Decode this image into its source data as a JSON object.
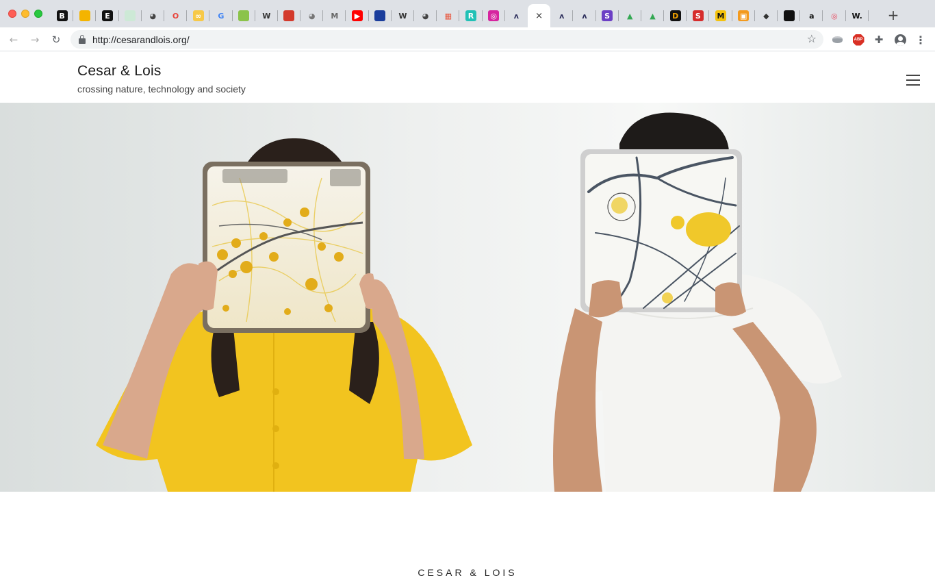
{
  "browser": {
    "tabs": [
      {
        "icon": "b-letter-icon",
        "glyph": "B",
        "bg": "#111111",
        "fg": "#ffffff"
      },
      {
        "icon": "yellow-slides-icon",
        "glyph": "",
        "bg": "#f4b400",
        "fg": "#ffffff"
      },
      {
        "icon": "e-letter-icon",
        "glyph": "E",
        "bg": "#111111",
        "fg": "#ffffff"
      },
      {
        "icon": "green-sheet-icon",
        "glyph": "",
        "bg": "#cde9d6",
        "fg": "#ffffff"
      },
      {
        "icon": "globe-icon",
        "glyph": "◕",
        "bg": "transparent",
        "fg": "#444444"
      },
      {
        "icon": "opera-icon",
        "glyph": "O",
        "bg": "transparent",
        "fg": "#e8453c"
      },
      {
        "icon": "infinity-icon",
        "glyph": "∞",
        "bg": "#f7c948",
        "fg": "#ffffff"
      },
      {
        "icon": "google-icon",
        "glyph": "G",
        "bg": "transparent",
        "fg": "#4285f4"
      },
      {
        "icon": "green-app-icon",
        "glyph": "",
        "bg": "#8bc34a",
        "fg": "#ffffff"
      },
      {
        "icon": "wikipedia-icon",
        "glyph": "W",
        "bg": "transparent",
        "fg": "#333333"
      },
      {
        "icon": "red-bookmark-icon",
        "glyph": "",
        "bg": "#d33a2c",
        "fg": "#ffffff"
      },
      {
        "icon": "globe-icon",
        "glyph": "◕",
        "bg": "transparent",
        "fg": "#777777"
      },
      {
        "icon": "medium-icon",
        "glyph": "M",
        "bg": "transparent",
        "fg": "#666666"
      },
      {
        "icon": "youtube-icon",
        "glyph": "▶",
        "bg": "#ff0000",
        "fg": "#ffffff"
      },
      {
        "icon": "blue-dot-icon",
        "glyph": "",
        "bg": "#1a3d9c",
        "fg": "#ffffff"
      },
      {
        "icon": "wikipedia-icon",
        "glyph": "W",
        "bg": "transparent",
        "fg": "#333333"
      },
      {
        "icon": "globe-icon",
        "glyph": "◕",
        "bg": "transparent",
        "fg": "#444444"
      },
      {
        "icon": "red-book-icon",
        "glyph": "▦",
        "bg": "transparent",
        "fg": "#e8553c"
      },
      {
        "icon": "r-letter-icon",
        "glyph": "R",
        "bg": "#21c1b6",
        "fg": "#ffffff"
      },
      {
        "icon": "instagram-icon",
        "glyph": "◎",
        "bg": "#d6249f",
        "fg": "#ffffff"
      },
      {
        "icon": "dark-a-icon",
        "glyph": "ʌ",
        "bg": "transparent",
        "fg": "#2b2d5b"
      },
      {
        "icon": "close-icon",
        "glyph": "×",
        "bg": "transparent",
        "fg": "#333333"
      },
      {
        "icon": "dark-a-icon",
        "glyph": "ʌ",
        "bg": "transparent",
        "fg": "#2b2d5b"
      },
      {
        "icon": "dark-a-icon",
        "glyph": "ʌ",
        "bg": "transparent",
        "fg": "#2b2d5b"
      },
      {
        "icon": "purple-s-icon",
        "glyph": "S",
        "bg": "#6c3fc5",
        "fg": "#ffffff"
      },
      {
        "icon": "google-drive-icon",
        "glyph": "▲",
        "bg": "transparent",
        "fg": "#34a853"
      },
      {
        "icon": "google-drive-icon",
        "glyph": "▲",
        "bg": "transparent",
        "fg": "#34a853"
      },
      {
        "icon": "d-letter-icon",
        "glyph": "D",
        "bg": "#111111",
        "fg": "#f4a300"
      },
      {
        "icon": "s-letter-icon",
        "glyph": "S",
        "bg": "#d62c2c",
        "fg": "#ffffff"
      },
      {
        "icon": "m-letter-icon",
        "glyph": "M",
        "bg": "#f4c20d",
        "fg": "#111111"
      },
      {
        "icon": "orange-grid-icon",
        "glyph": "▣",
        "bg": "#f39a1e",
        "fg": "#ffffff"
      },
      {
        "icon": "diamond-icon",
        "glyph": "◆",
        "bg": "transparent",
        "fg": "#333333"
      },
      {
        "icon": "black-circle-icon",
        "glyph": "",
        "bg": "#111111",
        "fg": "#ffffff"
      },
      {
        "icon": "amazon-icon",
        "glyph": "a",
        "bg": "transparent",
        "fg": "#111111"
      },
      {
        "icon": "target-icon",
        "glyph": "◎",
        "bg": "transparent",
        "fg": "#e84a5f"
      },
      {
        "icon": "w-dot-icon",
        "glyph": "W.",
        "bg": "transparent",
        "fg": "#111111"
      }
    ],
    "active_tab_index": 21,
    "new_tab_label": "+",
    "back_label": "←",
    "forward_label": "→",
    "reload_label": "↻",
    "url": "http://cesarandlois.org/",
    "bookmark_label": "☆",
    "abp_label": "ABP",
    "menu_label": "⋮"
  },
  "site": {
    "title": "Cesar & Lois",
    "tagline": "crossing nature, technology and society",
    "section_heading": "CESAR & LOIS"
  },
  "colors": {
    "accent_yellow": "#f2c41f",
    "hero_wall": "#e9eceb"
  }
}
